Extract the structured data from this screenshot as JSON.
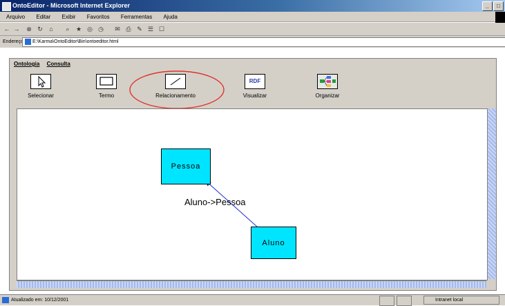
{
  "window": {
    "title": "OntoEditor - Microsoft Internet Explorer"
  },
  "menubar": {
    "items": [
      "Arquivo",
      "Editar",
      "Exibir",
      "Favoritos",
      "Ferramentas",
      "Ajuda"
    ]
  },
  "addressbar": {
    "label": "Endereço",
    "value": "E:\\Karma\\OntoEditor\\Bin\\ontoeditor.html"
  },
  "app": {
    "menu": [
      "Ontologia",
      "Consulta"
    ],
    "tools": [
      {
        "label": "Selecionar",
        "icon": "cursor-icon"
      },
      {
        "label": "Termo",
        "icon": "rectangle-icon"
      },
      {
        "label": "Relacionamento",
        "icon": "line-icon"
      },
      {
        "label": "Visualizar",
        "icon": "rdf-icon",
        "icon_text": "RDF"
      },
      {
        "label": "Organizar",
        "icon": "organize-icon"
      }
    ],
    "highlight_color": "#e0322b"
  },
  "diagram": {
    "nodes": [
      {
        "label": "Pessoa",
        "fill": "#00e5ff"
      },
      {
        "label": "Aluno",
        "fill": "#00e5ff"
      }
    ],
    "edges": [
      {
        "label": "Aluno->Pessoa",
        "from": "Aluno",
        "to": "Pessoa",
        "color": "#1f2bd6"
      }
    ]
  },
  "statusbar": {
    "text": "Atualizado em: 10/12/2001",
    "zone": "Intranet local"
  }
}
